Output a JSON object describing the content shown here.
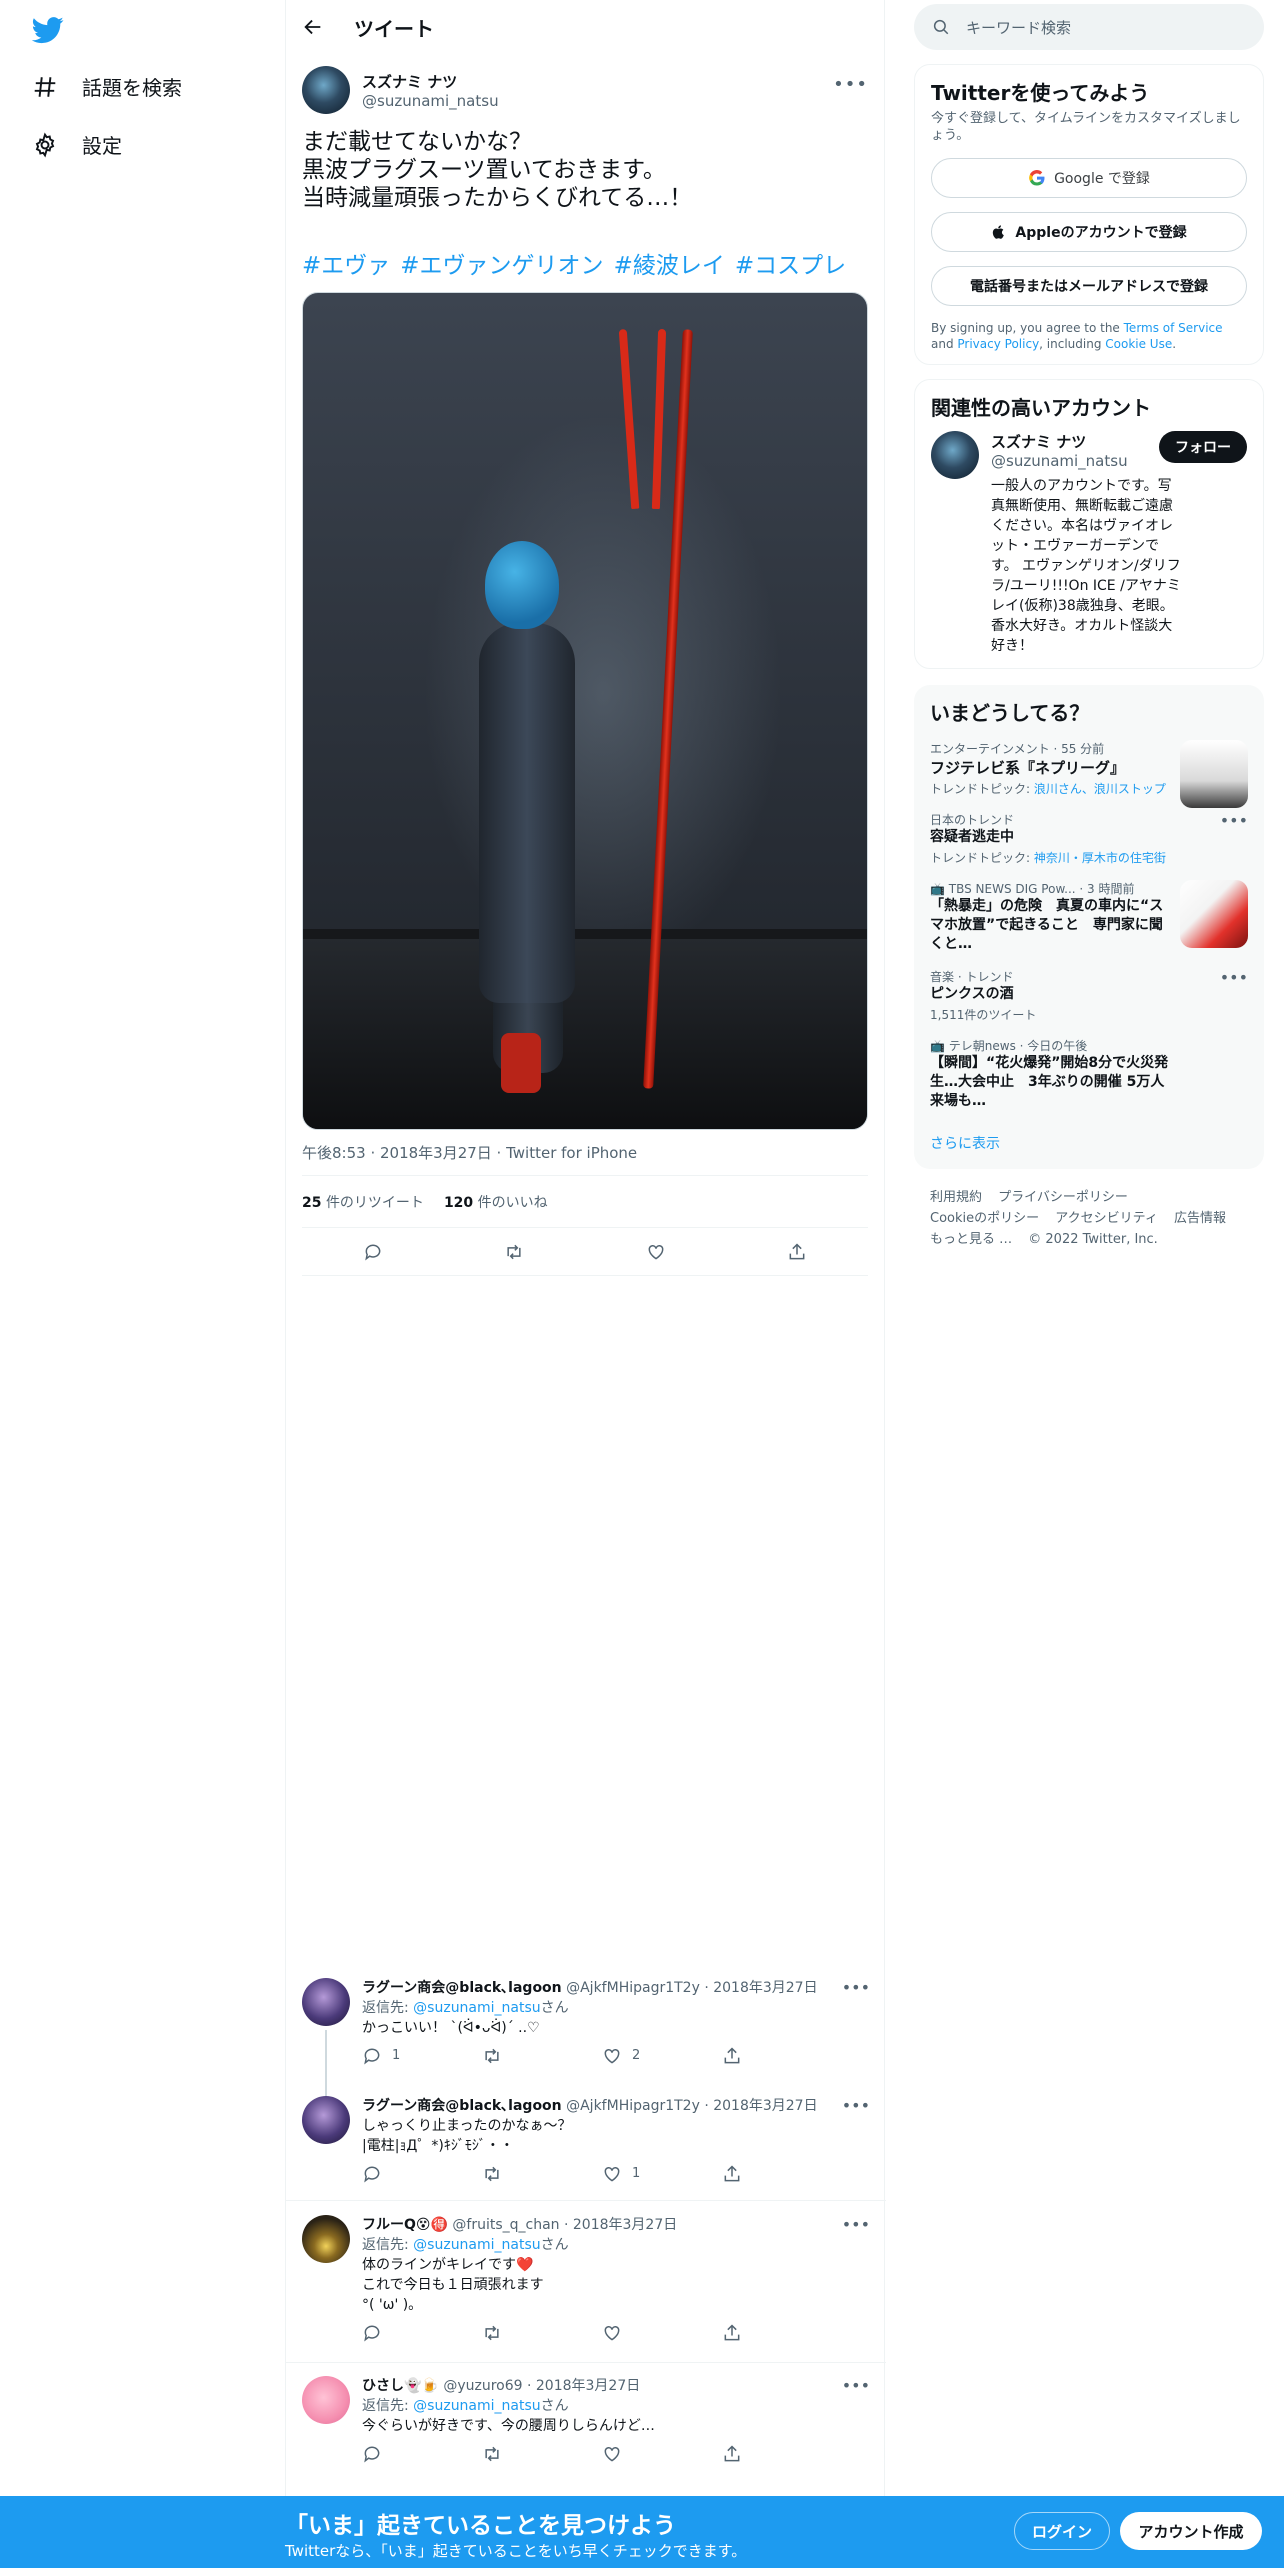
{
  "sidebar": {
    "explore_label": "話題を検索",
    "settings_label": "設定"
  },
  "header": {
    "title": "ツイート"
  },
  "tweet": {
    "author_name": "スズナミ ナツ",
    "author_handle": "@suzunami_natsu",
    "text_lines": [
      "まだ載せてないかな？",
      "黒波プラグスーツ置いておきます。",
      "当時減量頑張ったからくびれてる…！"
    ],
    "hashtags": [
      "#エヴァ",
      "#エヴァンゲリオン",
      "#綾波レイ",
      "#コスプレ"
    ],
    "meta": "午後8:53 · 2018年3月27日 · Twitter for iPhone",
    "retweets": "25",
    "retweets_label": "件のリツイート",
    "likes": "120",
    "likes_label": "件のいいね"
  },
  "replies": [
    {
      "name": "ラグーン商会@black､lagoon",
      "handle": "@AjkfMHipagr1T2y",
      "date": "· 2018年3月27日",
      "reply_to_prefix": "返信先: ",
      "reply_to": "@suzunami_natsu",
      "reply_to_suffix": "さん",
      "lines": [
        "かっこいい！ `(ᐛ•ᴗᐛ)´ ..♡"
      ],
      "reply_count": "1",
      "retweet_count": "",
      "like_count": "2"
    },
    {
      "name": "ラグーン商会@black､lagoon",
      "handle": "@AjkfMHipagr1T2y",
      "date": "· 2018年3月27日",
      "lines": [
        "しゃっくり止まったのかなぁ〜？",
        "|電柱|ｮД゜*)ｷｼﾞﾓｼﾞ・・"
      ],
      "reply_count": "",
      "retweet_count": "",
      "like_count": "1"
    },
    {
      "name": "フルーQ😵🉐",
      "handle": "@fruits_q_chan",
      "date": "· 2018年3月27日",
      "reply_to_prefix": "返信先: ",
      "reply_to": "@suzunami_natsu",
      "reply_to_suffix": "さん",
      "lines": [
        "体のラインがキレイです❤️",
        "これで今日も１日頑張れます",
        "°( 'ω' )｡"
      ],
      "reply_count": "",
      "retweet_count": "",
      "like_count": ""
    },
    {
      "name": "ひさし👻🍺",
      "handle": "@yuzuro69",
      "date": "· 2018年3月27日",
      "reply_to_prefix": "返信先: ",
      "reply_to": "@suzunami_natsu",
      "reply_to_suffix": "さん",
      "lines": [
        "今ぐらいが好きです、今の腰周りしらんけど…"
      ],
      "reply_count": "",
      "retweet_count": "",
      "like_count": ""
    }
  ],
  "right": {
    "search_placeholder": "キーワード検索",
    "signup": {
      "title": "Twitterを使ってみよう",
      "subtitle": "今すぐ登録して、タイムラインをカスタマイズしましょう。",
      "google": "Google で登録",
      "apple": "Appleのアカウントで登録",
      "phone": "電話番号またはメールアドレスで登録",
      "terms_prefix": "By signing up, you agree to the ",
      "terms_link": "Terms of Service",
      "terms_and": " and ",
      "privacy_link": "Privacy Policy",
      "terms_including": ", including ",
      "cookie_link": "Cookie Use",
      "terms_end": "."
    },
    "related": {
      "title": "関連性の高いアカウント",
      "name": "スズナミ ナツ",
      "handle": "@suzunami_natsu",
      "follow": "フォロー",
      "bio": "一般人のアカウントです。写真無断使用、無断転載ご遠慮ください。本名はヴァイオレット・エヴァーガーデンです。 エヴァンゲリオン/ダリフラ/ユーリ!!!On ICE /アヤナミレイ(仮称)38歳独身、老眼。香水大好き。オカルト怪談大好き！"
    },
    "trends": {
      "title": "いまどうしてる？",
      "items": [
        {
          "context": "エンターテインメント · 55 分前",
          "title": "フジテレビ系『ネプリーグ』",
          "sub_prefix": "トレンドトピック: ",
          "sub_links": "浪川さん、浪川ストップ"
        },
        {
          "context": "日本のトレンド",
          "title": "容疑者逃走中",
          "sub_prefix": "トレンドトピック: ",
          "sub_links": "神奈川・厚木市の住宅街"
        },
        {
          "context": "TBS NEWS DIG Pow... · 3 時間前",
          "title": "「熱暴走」の危険　真夏の車内に“スマホ放置”で起きること　専門家に聞くと…"
        },
        {
          "context": "音楽 · トレンド",
          "title": "ピンクスの酒",
          "sub": "1,511件のツイート"
        },
        {
          "context": "テレ朝news · 今日の午後",
          "title": "【瞬間】“花火爆発”開始8分で火災発生…大会中止　3年ぶりの開催 5万人来場も…"
        }
      ],
      "show_more": "さらに表示"
    },
    "footer": {
      "links": [
        "利用規約",
        "プライバシーポリシー",
        "Cookieのポリシー",
        "アクセシビリティ",
        "広告情報",
        "もっと見る …"
      ],
      "copyright": "© 2022 Twitter, Inc."
    }
  },
  "bottom_bar": {
    "title": "「いま」起きていることを見つけよう",
    "subtitle": "Twitterなら、「いま」起きていることをいち早くチェックできます。",
    "login": "ログイン",
    "signup": "アカウント作成"
  },
  "colors": {
    "accent": "#1d9bf0",
    "text": "#0f1419",
    "muted": "#536471",
    "verified": "#1d9bf0"
  }
}
